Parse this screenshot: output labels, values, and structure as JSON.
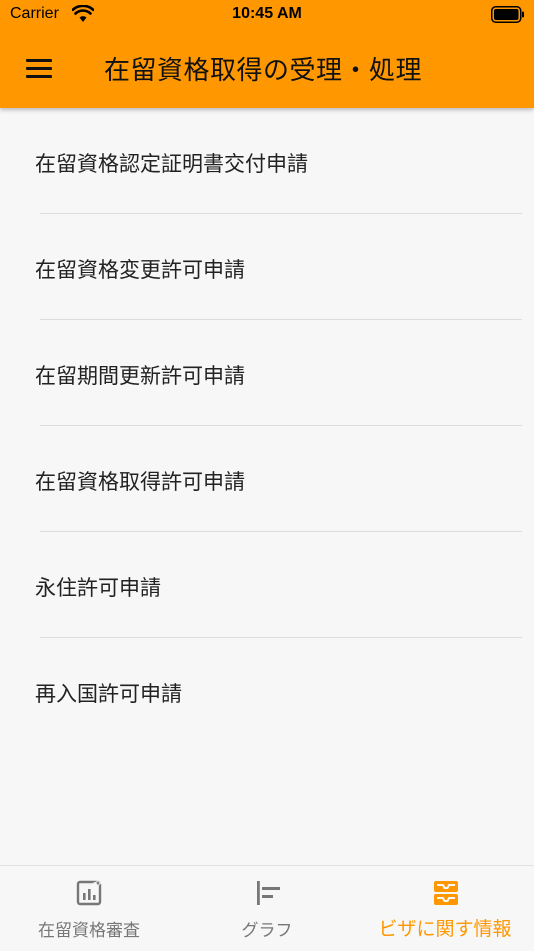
{
  "status_bar": {
    "carrier": "Carrier",
    "time": "10:45 AM"
  },
  "header": {
    "title": "在留資格取得の受理・処理"
  },
  "list": {
    "items": [
      {
        "label": "在留資格認定証明書交付申請"
      },
      {
        "label": "在留資格変更許可申請"
      },
      {
        "label": "在留期間更新許可申請"
      },
      {
        "label": "在留資格取得許可申請"
      },
      {
        "label": "永住許可申請"
      },
      {
        "label": "再入国許可申請"
      }
    ]
  },
  "tabs": [
    {
      "label": "在留資格審査",
      "icon": "chart-icon",
      "active": false
    },
    {
      "label": "グラフ",
      "icon": "bar-chart-horizontal-icon",
      "active": false
    },
    {
      "label": "ビザに関す情報",
      "icon": "inbox-icon",
      "active": true
    }
  ],
  "colors": {
    "accent": "#ff9800",
    "inactive": "#777777"
  }
}
